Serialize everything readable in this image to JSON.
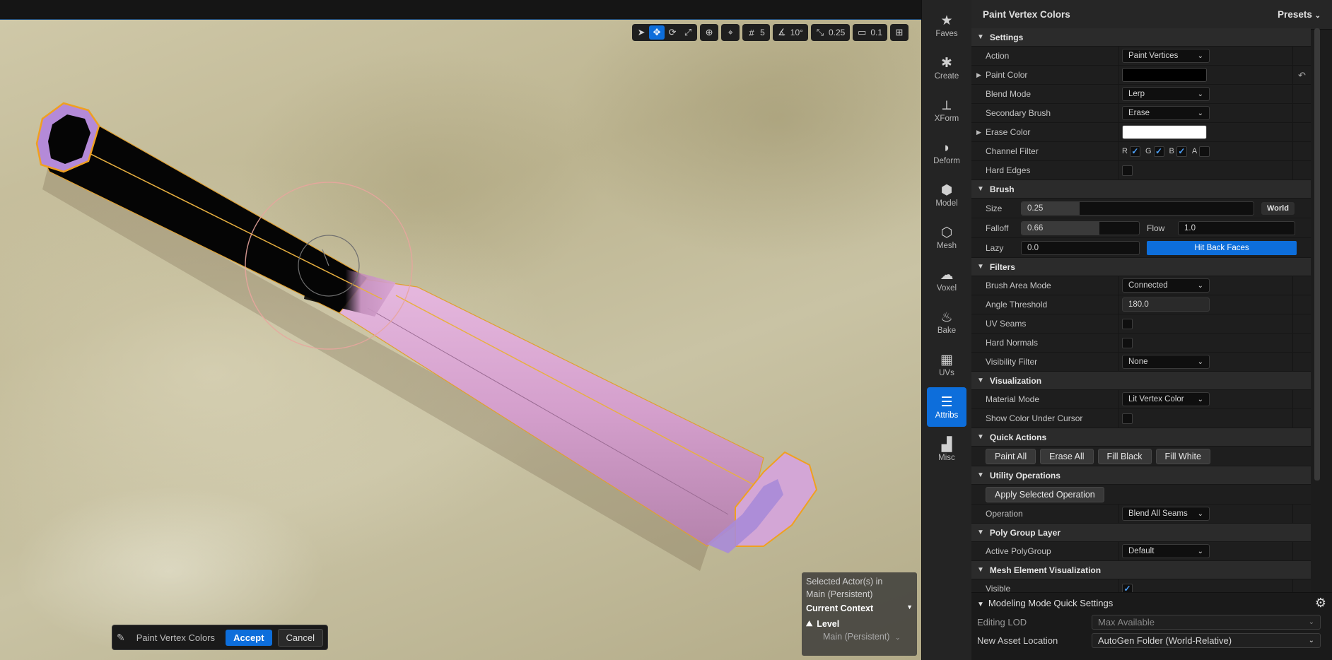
{
  "viewport_toolbar": {
    "grid_value": "5",
    "angle_value": "10°",
    "scale_value": "0.25",
    "camera_value": "0.1"
  },
  "accept_bar": {
    "tool_name": "Paint Vertex Colors",
    "accept_label": "Accept",
    "cancel_label": "Cancel"
  },
  "context": {
    "selected_line1": "Selected Actor(s) in",
    "selected_line2": "Main (Persistent)",
    "current_context": "Current Context",
    "level": "Level",
    "level_value": "Main (Persistent)"
  },
  "modes": [
    {
      "label": "Faves",
      "icon": "star-icon"
    },
    {
      "label": "Create",
      "icon": "create-icon"
    },
    {
      "label": "XForm",
      "icon": "xform-icon"
    },
    {
      "label": "Deform",
      "icon": "deform-icon"
    },
    {
      "label": "Model",
      "icon": "model-icon"
    },
    {
      "label": "Mesh",
      "icon": "mesh-icon"
    },
    {
      "label": "Voxel",
      "icon": "voxel-icon"
    },
    {
      "label": "Bake",
      "icon": "bake-icon"
    },
    {
      "label": "UVs",
      "icon": "uvs-icon"
    },
    {
      "label": "Attribs",
      "icon": "attribs-icon"
    },
    {
      "label": "Misc",
      "icon": "misc-icon"
    }
  ],
  "panel": {
    "title": "Paint Vertex Colors",
    "presets": "Presets"
  },
  "settings": {
    "header": "Settings",
    "action_label": "Action",
    "action_value": "Paint Vertices",
    "paint_color_label": "Paint Color",
    "paint_color": "#000000",
    "blend_mode_label": "Blend Mode",
    "blend_mode_value": "Lerp",
    "secondary_brush_label": "Secondary Brush",
    "secondary_brush_value": "Erase",
    "erase_color_label": "Erase Color",
    "erase_color": "#ffffff",
    "channel_filter_label": "Channel Filter",
    "channels": [
      {
        "name": "R",
        "checked": true
      },
      {
        "name": "G",
        "checked": true
      },
      {
        "name": "B",
        "checked": true
      },
      {
        "name": "A",
        "checked": false
      }
    ],
    "hard_edges_label": "Hard Edges"
  },
  "brush": {
    "header": "Brush",
    "size_label": "Size",
    "size_value": "0.25",
    "size_fill": 0.25,
    "world_label": "World",
    "falloff_label": "Falloff",
    "falloff_value": "0.66",
    "falloff_fill": 0.66,
    "flow_label": "Flow",
    "flow_value": "1.0",
    "lazy_label": "Lazy",
    "lazy_value": "0.0",
    "hit_back_label": "Hit Back Faces"
  },
  "filters": {
    "header": "Filters",
    "brush_area_label": "Brush Area Mode",
    "brush_area_value": "Connected",
    "angle_label": "Angle Threshold",
    "angle_value": "180.0",
    "uv_seams_label": "UV Seams",
    "hard_normals_label": "Hard Normals",
    "visibility_label": "Visibility Filter",
    "visibility_value": "None"
  },
  "visualization": {
    "header": "Visualization",
    "material_mode_label": "Material Mode",
    "material_mode_value": "Lit Vertex Color",
    "show_color_label": "Show Color Under Cursor"
  },
  "quick_actions": {
    "header": "Quick Actions",
    "buttons": [
      "Paint All",
      "Erase All",
      "Fill Black",
      "Fill White"
    ]
  },
  "utility": {
    "header": "Utility Operations",
    "apply_label": "Apply Selected Operation",
    "operation_label": "Operation",
    "operation_value": "Blend All Seams"
  },
  "polygroup": {
    "header": "Poly Group Layer",
    "active_label": "Active PolyGroup",
    "active_value": "Default"
  },
  "mesh_vis": {
    "header": "Mesh Element Visualization",
    "visible_label": "Visible"
  },
  "quick_settings": {
    "header": "Modeling Mode Quick Settings",
    "editing_lod_label": "Editing LOD",
    "editing_lod_value": "Max Available",
    "new_asset_label": "New Asset Location",
    "new_asset_value": "AutoGen Folder (World-Relative)"
  },
  "colors": {
    "accent": "#0d6edb",
    "mesh_pink": "#d8a3d2",
    "selection_orange": "#f0a020"
  }
}
